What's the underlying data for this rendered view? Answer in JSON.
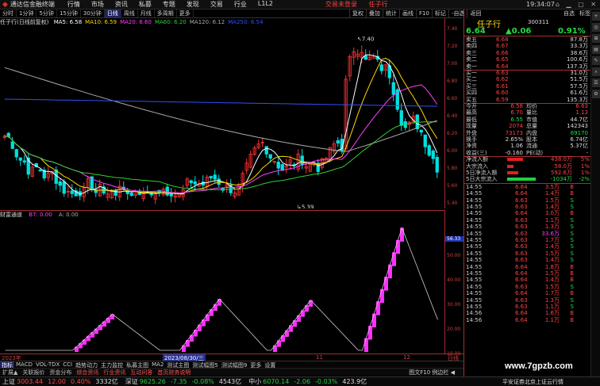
{
  "titlebar": {
    "app_title": "通达信金融终端",
    "menu": [
      "行情",
      "市场",
      "资讯",
      "私募",
      "专题",
      "发现",
      "交易",
      "行业",
      "L1L2"
    ],
    "center": [
      "交易未登录",
      "任子行"
    ],
    "clock": "19:34:07",
    "window_buttons": "⌂ ▁ ▢ ✕"
  },
  "toolbar": {
    "items": [
      "分时",
      "1分钟",
      "5分钟",
      "15分钟",
      "30分钟",
      "日线",
      "周线",
      "月线",
      "多周期",
      "更多"
    ],
    "active": 5,
    "right_items": [
      "复权",
      "叠加",
      "统计",
      "画线",
      "F10",
      "标记",
      "-自选",
      "返回"
    ]
  },
  "legend": {
    "title": "任子行(日线前复权)",
    "ma": [
      {
        "label": "MA5: 6.58",
        "color": "#ffffff"
      },
      {
        "label": "MA10: 6.59",
        "color": "#ffd700"
      },
      {
        "label": "MA20: 6.60",
        "color": "#ff40ff"
      },
      {
        "label": "MA60: 6.20",
        "color": "#30d030"
      },
      {
        "label": "MA120: 6.12",
        "color": "#aaaaaa"
      },
      {
        "label": "MA250: 6.54",
        "color": "#3050ff"
      }
    ]
  },
  "price_axis": [
    "7.40",
    "7.20",
    "7.00",
    "6.80",
    "6.60",
    "6.40",
    "6.20",
    "6.00",
    "5.80",
    "5.60",
    "5.40"
  ],
  "annotations": {
    "high": "7.40",
    "low": "5.39"
  },
  "indicator": {
    "name": "财富通道",
    "b7": "B7: 0.00",
    "a": "A: 0.00",
    "axis": [
      "50.00",
      "40.00",
      "30.00",
      "20.00",
      "10.00"
    ],
    "current": "56.33"
  },
  "xaxis": {
    "labels": [
      "2023年",
      "2023/08/30/三",
      "11",
      "12",
      "日线"
    ],
    "highlight": 1
  },
  "bottom_tabs": {
    "row1": [
      "指标",
      "MACD",
      "VOL-TDX",
      "CCI",
      "趋势动力",
      "主力监控",
      "私募主图",
      "MA2",
      "测试主图",
      "测试幅图5",
      "测试幅图9",
      "更多",
      "设置"
    ],
    "row2": [
      "扩展▲",
      "关联报价",
      "资金分布",
      "综合资讯",
      "行业资讯",
      "互动问答",
      "首页财务说明"
    ],
    "row2_right": "图文F10 例边栏 ◀"
  },
  "status": {
    "items": [
      {
        "name": "上证",
        "v1": "3003.44",
        "v2": "12.00",
        "v3": "0.40%",
        "v4": "3332亿",
        "dir": "up"
      },
      {
        "name": "深证",
        "v1": "9625.26",
        "v2": "-7.35",
        "v3": "-0.08%",
        "v4": "4543亿",
        "dir": "dn"
      },
      {
        "name": "中小",
        "v1": "6070.14",
        "v2": "-2.06",
        "v3": "-0.03%",
        "v4": "423.9亿",
        "dir": "dn"
      }
    ],
    "broker": "平安证券北京上证云行情"
  },
  "panel": {
    "top": [
      "自选",
      "标签"
    ],
    "name": "任子行",
    "code": "300311",
    "price": "6.64",
    "change": "▲0.06",
    "pct": "0.91%",
    "asks": [
      {
        "label": "卖五",
        "price": "6.68",
        "vol": "87.8万"
      },
      {
        "label": "卖四",
        "price": "6.67",
        "vol": "33.3万"
      },
      {
        "label": "卖三",
        "price": "6.66",
        "vol": "38.6万"
      },
      {
        "label": "卖二",
        "price": "6.65",
        "vol": "100.6万"
      },
      {
        "label": "卖一",
        "price": "6.64",
        "vol": "137.3万"
      }
    ],
    "bids": [
      {
        "label": "买一",
        "price": "6.63",
        "vol": "31.0万"
      },
      {
        "label": "买二",
        "price": "6.62",
        "vol": "51.5万"
      },
      {
        "label": "买三",
        "price": "6.61",
        "vol": "57.5万"
      },
      {
        "label": "买四",
        "price": "6.60",
        "vol": "61.6万"
      },
      {
        "label": "买五",
        "price": "6.59",
        "vol": "135.3万"
      }
    ],
    "stats": [
      {
        "l1": "今开",
        "v1": "6.58",
        "l2": "均价",
        "v2": "6.63"
      },
      {
        "l1": "最高",
        "v1": "6.70",
        "l2": "量比",
        "v2": "1.13"
      },
      {
        "l1": "最低",
        "v1": "6.55",
        "l2": "市值",
        "v2": "44.7亿"
      },
      {
        "l1": "现量",
        "v1": "2074",
        "l2": "总量",
        "v2": "142343"
      },
      {
        "l1": "外盘",
        "v1": "73173",
        "l2": "内盘",
        "v2": "69170"
      },
      {
        "l1": "换手",
        "v1": "2.65%",
        "l2": "股本",
        "v2": "6.74亿"
      },
      {
        "l1": "净资",
        "v1": "1.06",
        "l2": "流通",
        "v2": "5.37亿"
      },
      {
        "l1": "收益(三)",
        "v1": "-0.160",
        "l2": "PE(动)",
        "v2": "-"
      }
    ],
    "flows": [
      {
        "label": "净流入额",
        "value": "438.0万",
        "pct": "5%",
        "color": "red"
      },
      {
        "label": "大宗流入",
        "value": "58.0万",
        "pct": "1%",
        "color": "red"
      },
      {
        "label": "5日净流入额",
        "value": "592.6万",
        "pct": "1%",
        "color": "red"
      },
      {
        "label": "5日大宗流入",
        "value": "-1034万",
        "pct": "-2%",
        "color": "green"
      }
    ],
    "ticks": [
      {
        "t": "14:55",
        "p": "6.64",
        "v": "3.5万",
        "d": "B"
      },
      {
        "t": "14:55",
        "p": "6.64",
        "v": "1.4万",
        "d": "B"
      },
      {
        "t": "14:55",
        "p": "6.63",
        "v": "1.5万",
        "d": "S"
      },
      {
        "t": "14:55",
        "p": "6.63",
        "v": "1.4万",
        "d": "S"
      },
      {
        "t": "14:55",
        "p": "6.64",
        "v": "3.0万",
        "d": "B"
      },
      {
        "t": "14:55",
        "p": "6.63",
        "v": "1.1万",
        "d": "S"
      },
      {
        "t": "14:55",
        "p": "6.63",
        "v": "1.3万",
        "d": "S"
      },
      {
        "t": "14:55",
        "p": "6.63",
        "v": "33.6万",
        "d": "S"
      },
      {
        "t": "14:55",
        "p": "6.63",
        "v": "1.7万",
        "d": "S"
      },
      {
        "t": "14:55",
        "p": "6.63",
        "v": "1.4万",
        "d": "S"
      },
      {
        "t": "14:55",
        "p": "6.63",
        "v": "1.5万",
        "d": "S"
      },
      {
        "t": "14:55",
        "p": "6.63",
        "v": "1.4万",
        "d": "S"
      },
      {
        "t": "14:55",
        "p": "6.64",
        "v": "1.8万",
        "d": "B"
      },
      {
        "t": "14:55",
        "p": "6.64",
        "v": "1.5万",
        "d": "B"
      },
      {
        "t": "14:55",
        "p": "6.64",
        "v": "1.4万",
        "d": "B"
      },
      {
        "t": "14:55",
        "p": "6.63",
        "v": "1.5万",
        "d": "S"
      },
      {
        "t": "14:55",
        "p": "6.64",
        "v": "1.7万",
        "d": "B"
      },
      {
        "t": "14:55",
        "p": "6.63",
        "v": "1.3万",
        "d": "S"
      },
      {
        "t": "14:55",
        "p": "6.63",
        "v": "1.1万",
        "d": "S"
      },
      {
        "t": "14:56",
        "p": "6.64",
        "v": "1.6万",
        "d": "B"
      },
      {
        "t": "14:56",
        "p": "6.64",
        "v": "1.1万",
        "d": "B"
      }
    ]
  },
  "side_buttons": [
    "+",
    "◎",
    "⊞",
    "▤",
    "✎",
    "⌕",
    "☰",
    "⚙"
  ],
  "watermark": "www.7gpzb.com"
}
